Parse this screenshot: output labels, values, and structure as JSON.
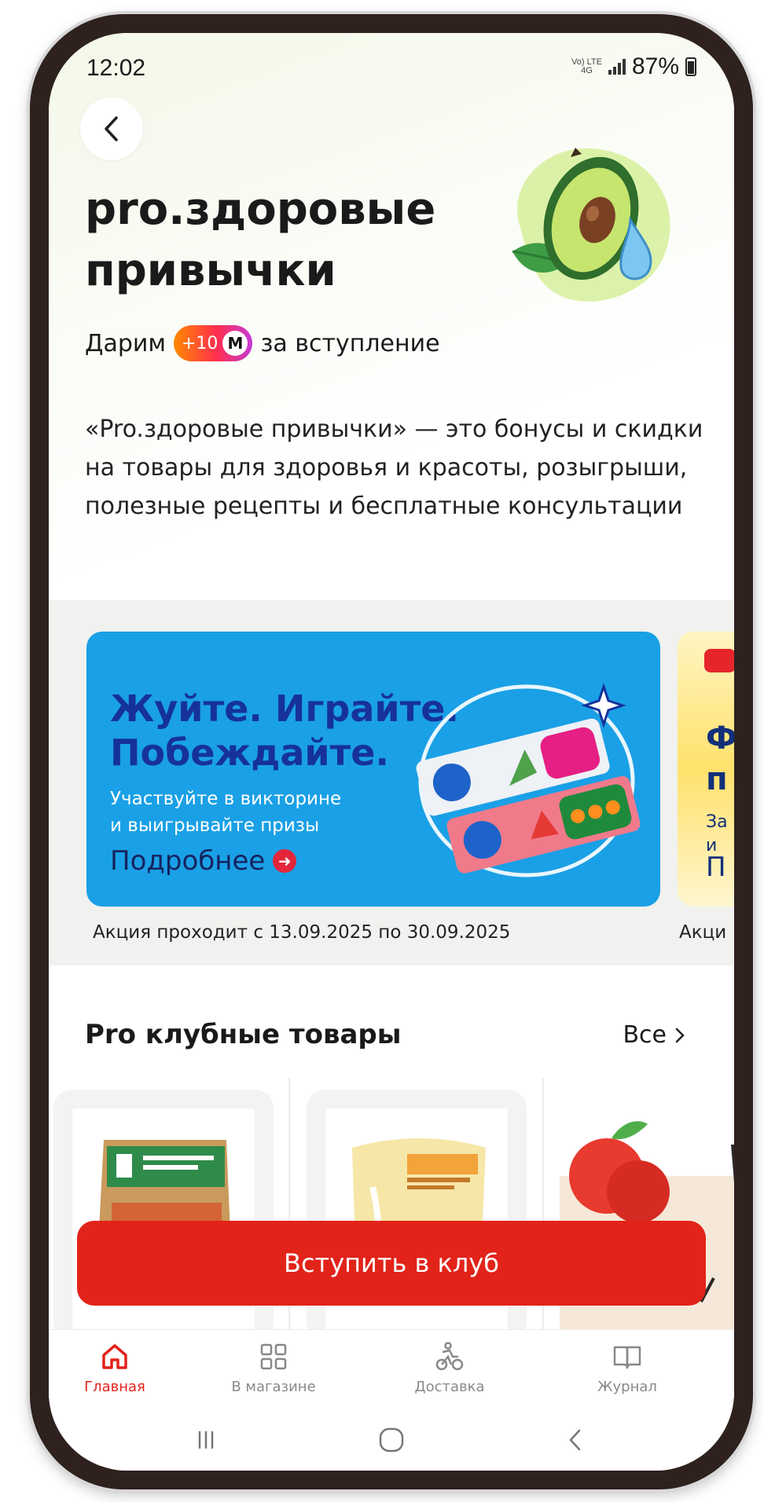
{
  "status_bar": {
    "time": "12:02",
    "network_line1": "Vo) LTE",
    "network_line2": "4G",
    "battery": "87%"
  },
  "hero": {
    "back_icon": "chevron-left-icon",
    "title": "pro.здоровые привычки",
    "gift_prefix": "Дарим",
    "points_value": "+10",
    "points_letter": "М",
    "gift_suffix": "за вступление",
    "illustration": "avocado-illustration",
    "description": "«Pro.здоровые привычки» — это бонусы и скидки на товары для здоровья и красоты, розыгрыши, полезные рецепты и бесплатные консультации"
  },
  "promo": {
    "cards": [
      {
        "title_line1": "Жуйте. Играйте.",
        "title_line2": "Побеждайте.",
        "subtitle_line1": "Участвуйте в викторине",
        "subtitle_line2": "и выигрывайте призы",
        "more_label": "Подробнее",
        "dates": "Акция проходит с 13.09.2025 по 30.09.2025",
        "bg_color": "#1aa0e6"
      },
      {
        "title_line1": "Ф",
        "title_line2": "п",
        "subtitle_line1": "За",
        "subtitle_line2": "и",
        "more_label": "П",
        "dates": "Акци"
      }
    ]
  },
  "club_products": {
    "title": "Pro клубные товары",
    "all_label": "Все",
    "items": [
      {
        "name": "product-pasta-pack"
      },
      {
        "name": "product-maria-cookies"
      },
      {
        "name": "product-apples"
      }
    ]
  },
  "cta": {
    "join_label": "Вступить в клуб",
    "color": "#e2231a"
  },
  "tabs": [
    {
      "label": "Главная",
      "icon": "home-icon",
      "active": true
    },
    {
      "label": "В магазине",
      "icon": "grid-icon",
      "active": false
    },
    {
      "label": "Доставка",
      "icon": "courier-icon",
      "active": false
    },
    {
      "label": "Журнал",
      "icon": "book-icon",
      "active": false
    }
  ],
  "system_nav": [
    "recents-icon",
    "home-circle-icon",
    "back-arrow-icon"
  ],
  "colors": {
    "accent": "#e2231a",
    "promo_blue": "#1aa0e6",
    "promo_text": "#16319b"
  }
}
